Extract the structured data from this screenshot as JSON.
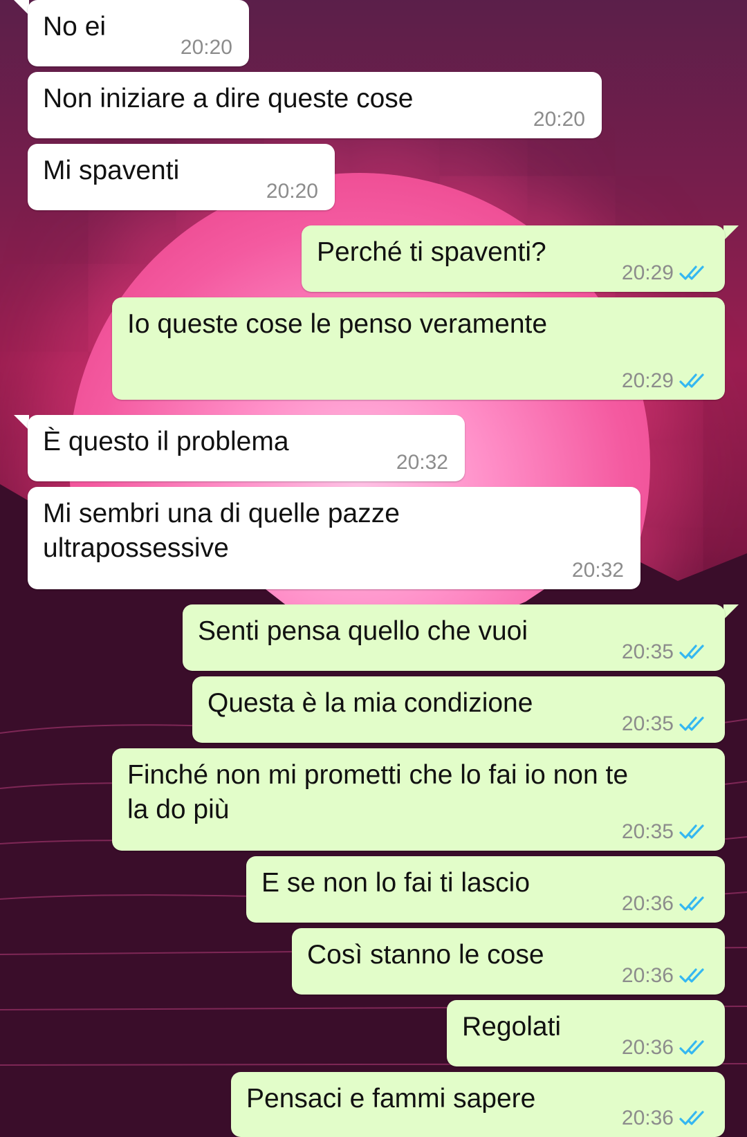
{
  "messages": [
    {
      "text": "No ei",
      "time": "20:20",
      "direction": "incoming",
      "read": false
    },
    {
      "text": "Non iniziare a dire queste cose",
      "time": "20:20",
      "direction": "incoming",
      "read": false
    },
    {
      "text": "Mi spaventi",
      "time": "20:20",
      "direction": "incoming",
      "read": false
    },
    {
      "text": "Perché ti spaventi?",
      "time": "20:29",
      "direction": "outgoing",
      "read": true
    },
    {
      "text": "Io queste cose le penso veramente",
      "time": "20:29",
      "direction": "outgoing",
      "read": true
    },
    {
      "text": "È questo il problema",
      "time": "20:32",
      "direction": "incoming",
      "read": false
    },
    {
      "text": "Mi sembri una di quelle pazze\nultrapossessive",
      "time": "20:32",
      "direction": "incoming",
      "read": false
    },
    {
      "text": "Senti pensa quello che vuoi",
      "time": "20:35",
      "direction": "outgoing",
      "read": true
    },
    {
      "text": "Questa è la mia condizione",
      "time": "20:35",
      "direction": "outgoing",
      "read": true
    },
    {
      "text": "Finché non mi prometti che lo fai io non te\nla do più",
      "time": "20:35",
      "direction": "outgoing",
      "read": true
    },
    {
      "text": "E se non lo fai ti lascio",
      "time": "20:36",
      "direction": "outgoing",
      "read": true
    },
    {
      "text": "Così stanno le cose",
      "time": "20:36",
      "direction": "outgoing",
      "read": true
    },
    {
      "text": "Regolati",
      "time": "20:36",
      "direction": "outgoing",
      "read": true
    },
    {
      "text": "Pensaci e fammi sapere",
      "time": "20:36",
      "direction": "outgoing",
      "read": true
    }
  ],
  "colors": {
    "incoming_bubble": "#ffffff",
    "outgoing_bubble": "#e2fdc9",
    "timestamp": "#8c8c8c",
    "read_ticks": "#34b7f1",
    "wallpaper_accent": "#f45aa0"
  },
  "icons": {
    "read_receipt": "double-check-icon"
  }
}
